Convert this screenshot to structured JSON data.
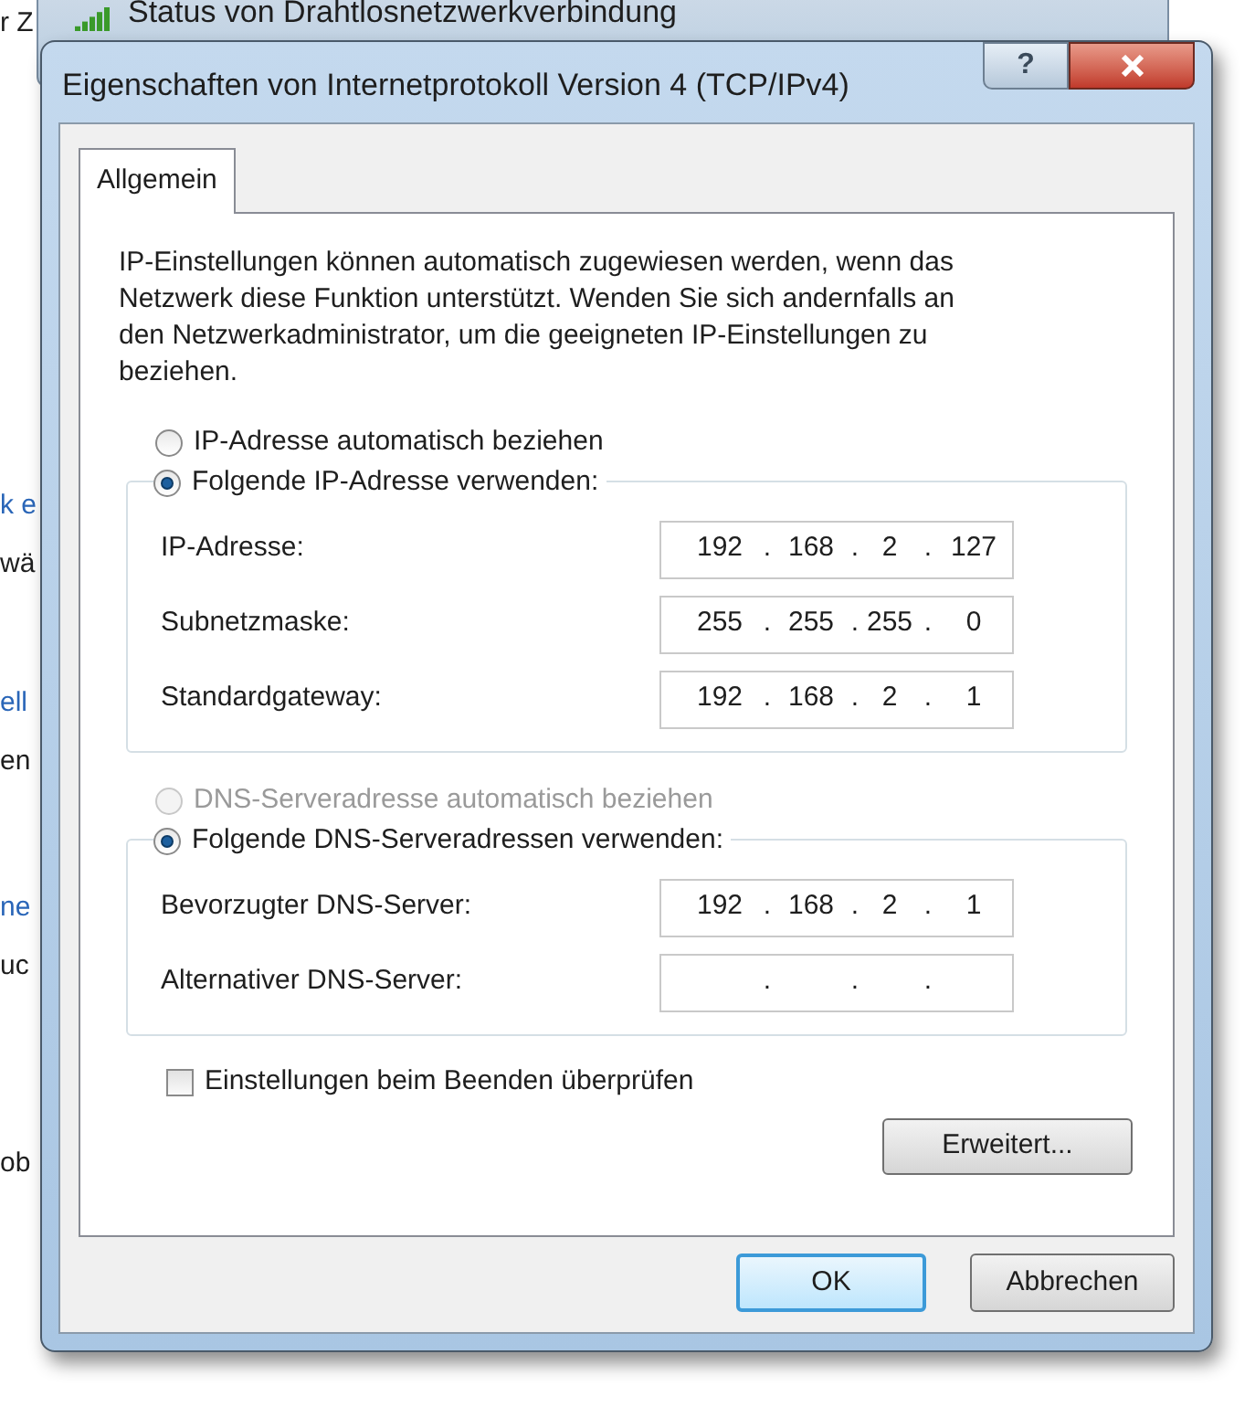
{
  "background_window": {
    "title": "Status von Drahtlosnetzwerkverbindung",
    "side_fragments": [
      "r Z",
      "k e",
      "wä",
      "ell",
      "en",
      "ne",
      "uc",
      "ob"
    ]
  },
  "dialog": {
    "title": "Eigenschaften von Internetprotokoll Version 4 (TCP/IPv4)",
    "help": "?"
  },
  "tabs": [
    {
      "label": "Allgemein",
      "selected": true
    }
  ],
  "description": "IP-Einstellungen können automatisch zugewiesen werden, wenn das Netzwerk diese Funktion unterstützt. Wenden Sie sich andernfalls an den Netzwerkadministrator, um die geeigneten IP-Einstellungen zu beziehen.",
  "ip_section": {
    "auto_option": {
      "label": "IP-Adresse automatisch beziehen",
      "selected": false,
      "disabled": false
    },
    "manual_option": {
      "label": "Folgende IP-Adresse verwenden:",
      "selected": true,
      "disabled": false
    },
    "fields": [
      {
        "label": "IP-Adresse:",
        "octets": [
          "192",
          "168",
          "2",
          "127"
        ],
        "separator": "."
      },
      {
        "label": "Subnetzmaske:",
        "octets": [
          "255",
          "255",
          "255",
          "0"
        ],
        "separator": "."
      },
      {
        "label": "Standardgateway:",
        "octets": [
          "192",
          "168",
          "2",
          "1"
        ],
        "separator": "."
      }
    ]
  },
  "dns_section": {
    "auto_option": {
      "label": "DNS-Serveradresse automatisch beziehen",
      "selected": false,
      "disabled": true
    },
    "manual_option": {
      "label": "Folgende DNS-Serveradressen verwenden:",
      "selected": true,
      "disabled": false
    },
    "fields": [
      {
        "label": "Bevorzugter DNS-Server:",
        "octets": [
          "192",
          "168",
          "2",
          "1"
        ],
        "separator": "."
      },
      {
        "label": "Alternativer DNS-Server:",
        "separator": "."
      }
    ]
  },
  "validate_checkbox": {
    "label": "Einstellungen beim Beenden überprüfen",
    "checked": false
  },
  "advanced_button": "Erweitert...",
  "buttons": [
    {
      "label": "OK",
      "kind": "default"
    },
    {
      "label": "Abbrechen",
      "kind": "normal"
    }
  ]
}
